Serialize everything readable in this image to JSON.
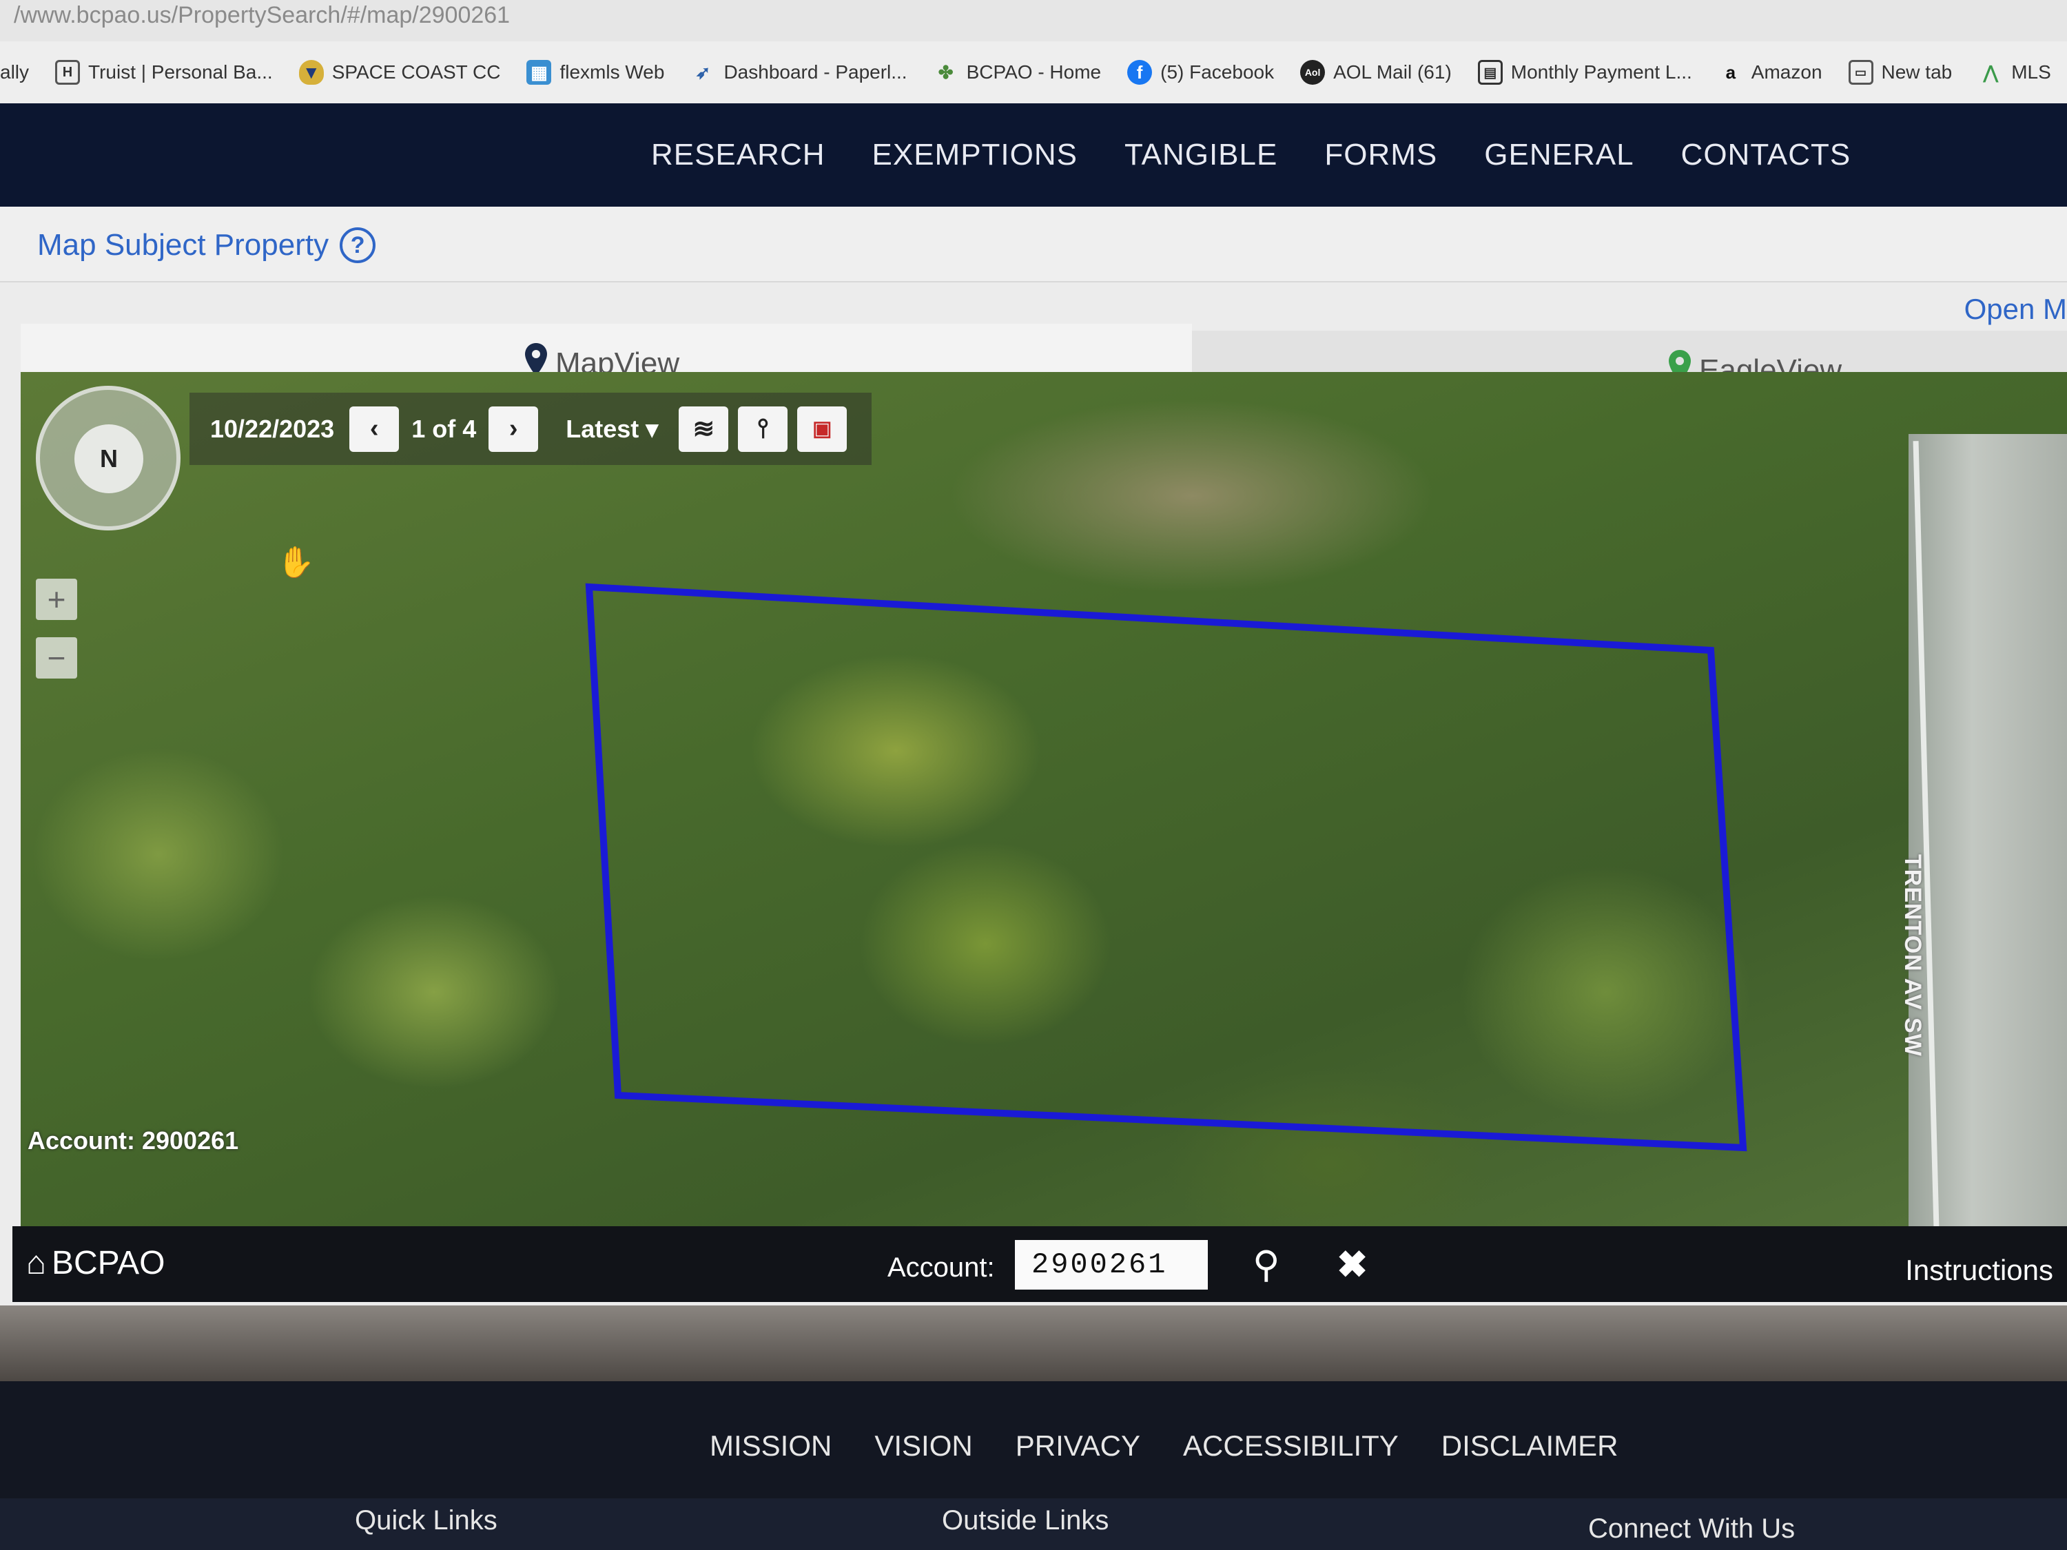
{
  "browser": {
    "url": "/www.bcpao.us/PropertySearch/#/map/2900261",
    "bookmarks": [
      {
        "icon": "ally-icon",
        "label": "ally"
      },
      {
        "icon": "truist-icon",
        "label": "Truist | Personal Ba..."
      },
      {
        "icon": "space-coast-icon",
        "label": "SPACE COAST CC"
      },
      {
        "icon": "flexmls-icon",
        "label": "flexmls Web"
      },
      {
        "icon": "paperless-icon",
        "label": "Dashboard - Paperl..."
      },
      {
        "icon": "bcpao-icon",
        "label": "BCPAO - Home"
      },
      {
        "icon": "facebook-icon",
        "label": "(5) Facebook"
      },
      {
        "icon": "aol-icon",
        "label": "AOL Mail (61)"
      },
      {
        "icon": "calendar-icon",
        "label": "Monthly Payment L..."
      },
      {
        "icon": "amazon-icon",
        "label": "Amazon"
      },
      {
        "icon": "new-tab-icon",
        "label": "New tab"
      },
      {
        "icon": "mls-icon",
        "label": "MLS"
      }
    ]
  },
  "nav": {
    "items": [
      "RESEARCH",
      "EXEMPTIONS",
      "TANGIBLE",
      "FORMS",
      "GENERAL",
      "CONTACTS"
    ]
  },
  "subject": {
    "title": "Map Subject Property",
    "help": "?",
    "open_link": "Open M"
  },
  "tabs": {
    "map_view": "MapView",
    "eagle_view": "EagleView"
  },
  "map": {
    "date": "10/22/2023",
    "pager": "1 of 4",
    "latest": "Latest",
    "compass": "N",
    "zoom_in": "+",
    "zoom_out": "−",
    "street": "TRENTON AV SW",
    "account_overlay": "Account: 2900261",
    "parcel_color": "#1a1ad6"
  },
  "map_footer": {
    "home": "BCPAO",
    "account_label": "Account:",
    "account_value": "2900261",
    "instructions": "Instructions"
  },
  "footer": {
    "links": [
      "MISSION",
      "VISION",
      "PRIVACY",
      "ACCESSIBILITY",
      "DISCLAIMER"
    ],
    "quick_links": "Quick Links",
    "outside_links": "Outside Links",
    "connect": "Connect With Us"
  }
}
